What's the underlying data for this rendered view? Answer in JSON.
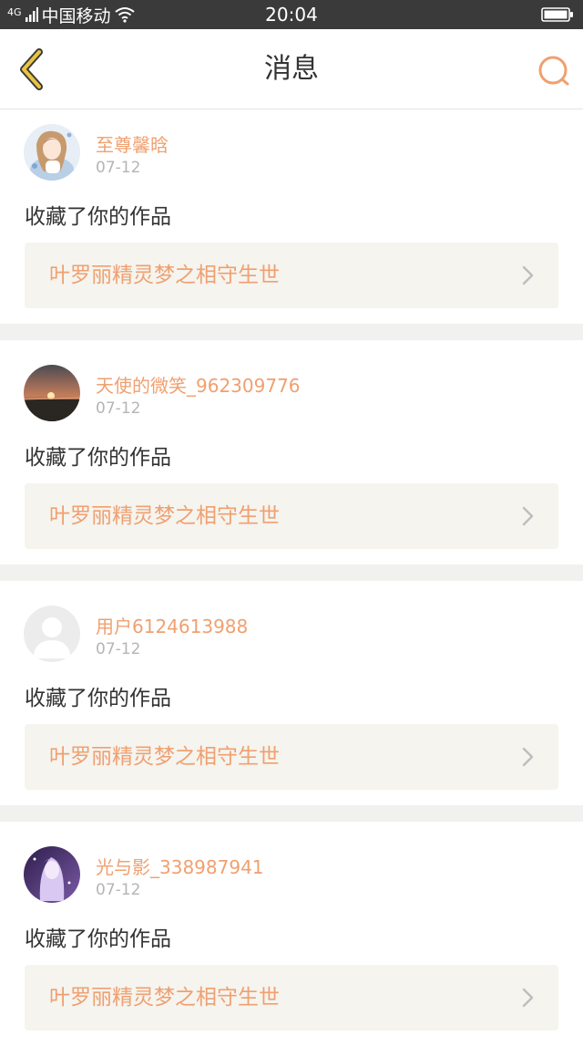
{
  "status_bar": {
    "network": "4G",
    "carrier": "中国移动",
    "time": "20:04",
    "icons": [
      "signal-icon",
      "wifi-icon",
      "battery-icon"
    ]
  },
  "header": {
    "title": "消息",
    "back_icon": "chevron-left-icon",
    "search_icon": "search-icon"
  },
  "colors": {
    "accent": "#f0a070",
    "back_icon": "#e9c440",
    "work_box_bg": "#f5f4ef",
    "separator": "#f1f1ef"
  },
  "messages": [
    {
      "username": "至尊馨晗",
      "date": "07-12",
      "action": "收藏了你的作品",
      "work_title": "叶罗丽精灵梦之相守生世",
      "avatar": "anime-girl-avatar"
    },
    {
      "username": "天使的微笑_962309776",
      "date": "07-12",
      "action": "收藏了你的作品",
      "work_title": "叶罗丽精灵梦之相守生世",
      "avatar": "sunset-avatar"
    },
    {
      "username": "用户6124613988",
      "date": "07-12",
      "action": "收藏了你的作品",
      "work_title": "叶罗丽精灵梦之相守生世",
      "avatar": "default-user-avatar"
    },
    {
      "username": "光与影_338987941",
      "date": "07-12",
      "action": "收藏了你的作品",
      "work_title": "叶罗丽精灵梦之相守生世",
      "avatar": "purple-hair-girl-avatar"
    }
  ]
}
